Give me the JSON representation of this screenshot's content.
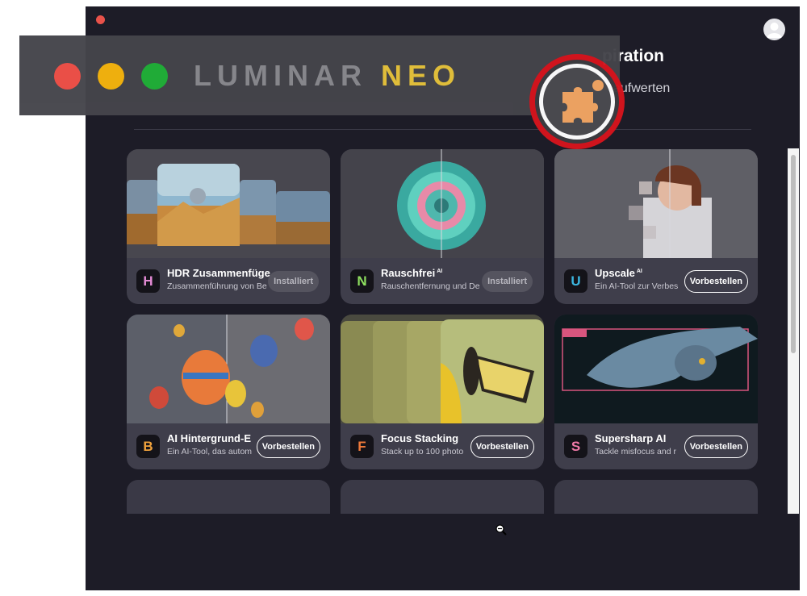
{
  "window": {
    "title": "piration",
    "subtitle": "aufwerten"
  },
  "banner": {
    "logo_part1": "LUMINAR",
    "logo_part2": "NEO",
    "extensions_icon": "puzzle-piece-icon"
  },
  "cards": [
    {
      "name": "HDR Zusammenfüge",
      "sup": "",
      "desc": "Zusammenführung von Be",
      "button": "Installiert",
      "status": "installed",
      "icon_letter": "H",
      "icon_color": "#e38bd4"
    },
    {
      "name": "Rauschfrei",
      "sup": "AI",
      "desc": "Rauschentfernung und De",
      "button": "Installiert",
      "status": "installed",
      "icon_letter": "N",
      "icon_color": "#8fe060"
    },
    {
      "name": "Upscale",
      "sup": "AI",
      "desc": "Ein AI-Tool zur Verbes",
      "button": "Vorbestellen",
      "status": "preorder",
      "icon_letter": "U",
      "icon_color": "#3bb6e0"
    },
    {
      "name": "AI Hintergrund-E",
      "sup": "",
      "desc": "Ein AI-Tool, das autom",
      "button": "Vorbestellen",
      "status": "preorder",
      "icon_letter": "B",
      "icon_color": "#f0a23c"
    },
    {
      "name": "Focus Stacking",
      "sup": "",
      "desc": "Stack up to 100 photo",
      "button": "Vorbestellen",
      "status": "preorder",
      "icon_letter": "F",
      "icon_color": "#ee7a3a"
    },
    {
      "name": "Supersharp AI",
      "sup": "",
      "desc": "Tackle misfocus and r",
      "button": "Vorbestellen",
      "status": "preorder",
      "icon_letter": "S",
      "icon_color": "#f07aa8"
    }
  ],
  "colors": {
    "background": "#1d1c27",
    "card": "#3f3e4b",
    "highlight": "#d6141d"
  }
}
